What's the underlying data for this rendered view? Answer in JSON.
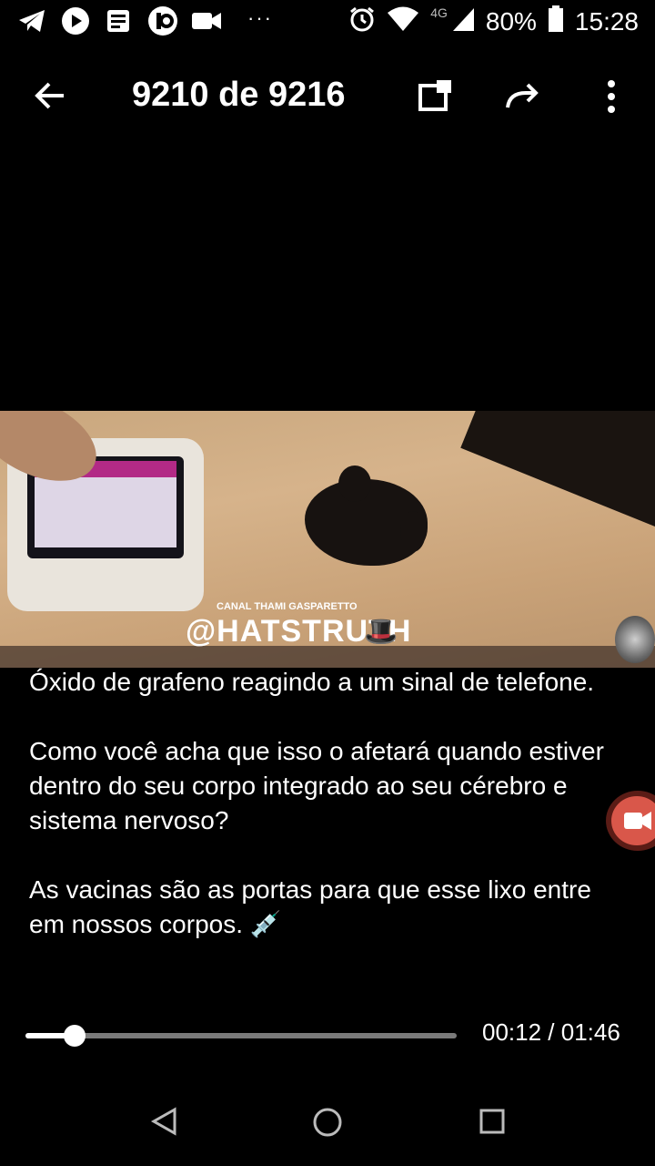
{
  "status_bar": {
    "icons_left": [
      "telegram-icon",
      "youtube-icon",
      "news-icon",
      "app-icon",
      "video-camera-icon"
    ],
    "more_dots": "···",
    "network": "4G",
    "battery": "80%",
    "time": "15:28"
  },
  "app_bar": {
    "title": "9210 de 9216"
  },
  "video": {
    "watermark_channel": "CANAL THAMI GASPARETTO",
    "watermark_handle": "@HATSTRUTH",
    "watermark_emoji": "🎩"
  },
  "caption": {
    "paragraphs": [
      "Óxido de grafeno reagindo a um sinal de telefone.",
      "Como você acha que isso o afetará quando estiver dentro do seu corpo integrado ao seu cérebro e sistema nervoso?",
      "As vacinas são as portas para que esse lixo entre em nossos corpos. 💉"
    ]
  },
  "player": {
    "progress": 0.113,
    "time_label": "00:12 / 01:46"
  },
  "colors": {
    "background": "#000000",
    "seek_track": "#7a7a7a",
    "seek_fill": "#ffffff",
    "record_button": "#d9574a"
  }
}
